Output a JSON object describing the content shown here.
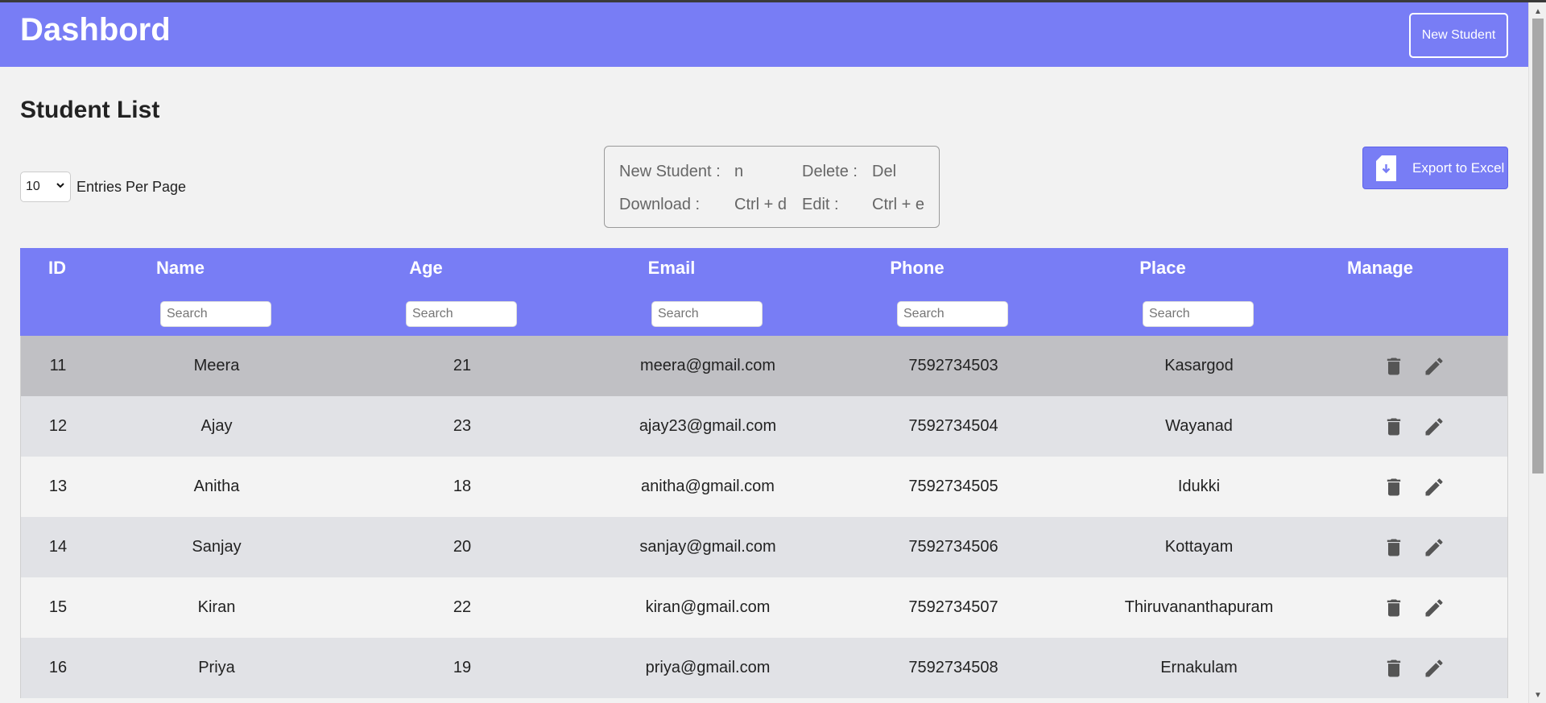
{
  "header": {
    "title": "Dashbord",
    "new_student_label": "New Student"
  },
  "page_title": "Student List",
  "entries": {
    "selected": "10",
    "label": "Entries Per Page"
  },
  "shortcuts": {
    "new_student_label": "New Student :",
    "new_student_key": "n",
    "delete_label": "Delete :",
    "delete_key": "Del",
    "download_label": "Download :",
    "download_key": "Ctrl + d",
    "edit_label": "Edit :",
    "edit_key": "Ctrl + e"
  },
  "export": {
    "label": "Export to Excel"
  },
  "table": {
    "columns": [
      "ID",
      "Name",
      "Age",
      "Email",
      "Phone",
      "Place",
      "Manage"
    ],
    "search_placeholder": "Search",
    "rows": [
      [
        "11",
        "Meera",
        "21",
        "meera@gmail.com",
        "7592734503",
        "Kasargod"
      ],
      [
        "12",
        "Ajay",
        "23",
        "ajay23@gmail.com",
        "7592734504",
        "Wayanad"
      ],
      [
        "13",
        "Anitha",
        "18",
        "anitha@gmail.com",
        "7592734505",
        "Idukki"
      ],
      [
        "14",
        "Sanjay",
        "20",
        "sanjay@gmail.com",
        "7592734506",
        "Kottayam"
      ],
      [
        "15",
        "Kiran",
        "22",
        "kiran@gmail.com",
        "7592734507",
        "Thiruvananthapuram"
      ],
      [
        "16",
        "Priya",
        "19",
        "priya@gmail.com",
        "7592734508",
        "Ernakulam"
      ]
    ]
  },
  "icons": {
    "delete": "trash-icon",
    "edit": "pencil-icon",
    "export": "file-download-icon"
  },
  "colors": {
    "accent": "#787df5",
    "highlight_row": "#c0c0c4",
    "alt_row": "#e1e2e6"
  }
}
